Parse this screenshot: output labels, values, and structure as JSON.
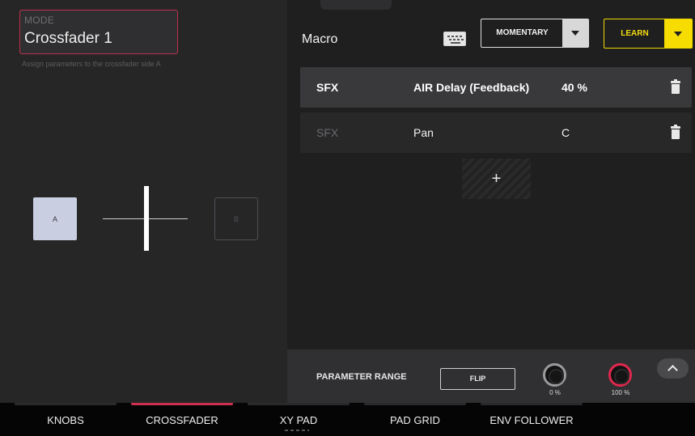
{
  "mode": {
    "label": "MODE",
    "value": "Crossfader 1",
    "help": "Assign parameters to the crossfader side A"
  },
  "crossfader": {
    "side_a": "A",
    "side_b": "B",
    "position": 0.5
  },
  "macro": {
    "title": "Macro",
    "keyboard_icon": "keyboard-icon",
    "mode_select": {
      "value": "MOMENTARY"
    },
    "learn_label": "LEARN"
  },
  "assignments": [
    {
      "source": "SFX",
      "parameter": "AIR Delay (Feedback)",
      "value": "40 %"
    },
    {
      "source": "SFX",
      "parameter": "Pan",
      "value": "C"
    }
  ],
  "add_label": "+",
  "range": {
    "label": "PARAMETER RANGE",
    "flip_label": "FLIP",
    "min_value": "0 %",
    "max_value": "100 %"
  },
  "tabs": [
    {
      "label": "KNOBS",
      "active": false
    },
    {
      "label": "CROSSFADER",
      "active": true
    },
    {
      "label": "XY PAD",
      "active": false
    },
    {
      "label": "PAD GRID",
      "active": false
    },
    {
      "label": "ENV FOLLOWER",
      "active": false
    }
  ],
  "colors": {
    "accent_red": "#d0304f",
    "learn_yellow": "#f6dc00",
    "side_a_fill": "#c9cfe0"
  }
}
